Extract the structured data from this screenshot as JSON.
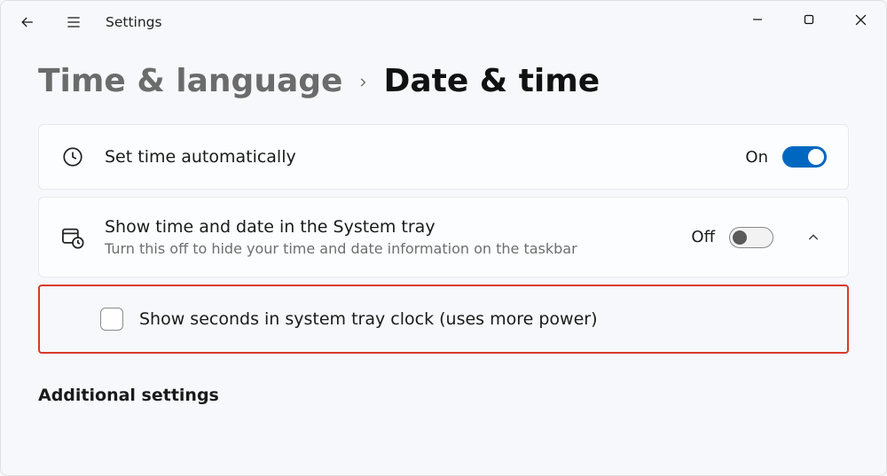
{
  "window": {
    "app_title": "Settings"
  },
  "breadcrumb": {
    "parent": "Time & language",
    "current": "Date & time"
  },
  "rows": {
    "set_time_auto": {
      "title": "Set time automatically",
      "toggle_label": "On",
      "toggle_state": "on"
    },
    "show_tray": {
      "title": "Show time and date in the System tray",
      "subtitle": "Turn this off to hide your time and date information on the taskbar",
      "toggle_label": "Off",
      "toggle_state": "off"
    },
    "show_seconds": {
      "label": "Show seconds in system tray clock (uses more power)",
      "checked": false
    }
  },
  "sections": {
    "additional": "Additional settings"
  }
}
